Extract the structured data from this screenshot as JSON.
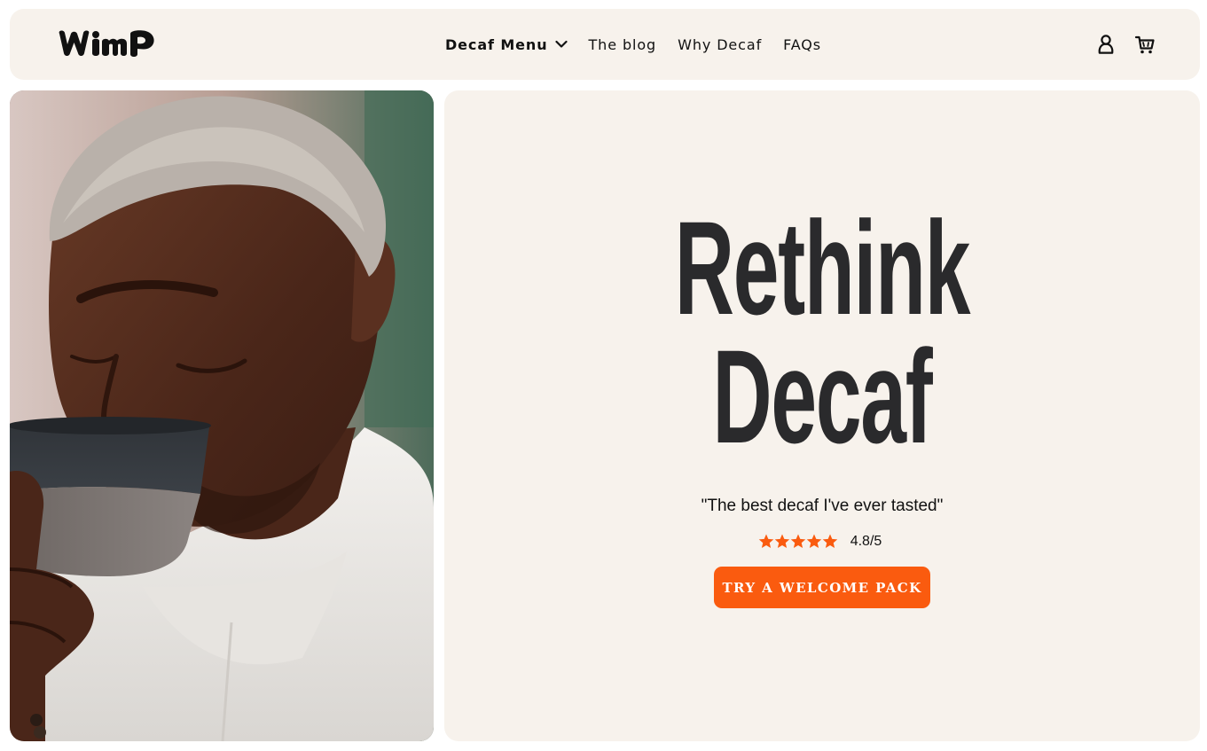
{
  "header": {
    "logo_text": "WiMP",
    "nav": [
      {
        "label": "Decaf Menu",
        "has_dropdown": true,
        "icon": "chevron-down-icon"
      },
      {
        "label": "The blog"
      },
      {
        "label": "Why Decaf"
      },
      {
        "label": "FAQs"
      }
    ],
    "icons": [
      "account-icon",
      "cart-icon"
    ]
  },
  "hero": {
    "image": "man-sipping-coffee-from-dark-cup",
    "headline_line1": "Rethink",
    "headline_line2": "Decaf",
    "quote": "\"The best decaf I've ever tasted\"",
    "rating": {
      "stars": 5,
      "value": "4.8/5",
      "star_color": "#fa5b0f"
    },
    "cta_label": "TRY A WELCOME PACK"
  },
  "colors": {
    "panel_bg": "#f7f2ec",
    "accent": "#fa5b0f",
    "headline": "#2a2a2c"
  }
}
